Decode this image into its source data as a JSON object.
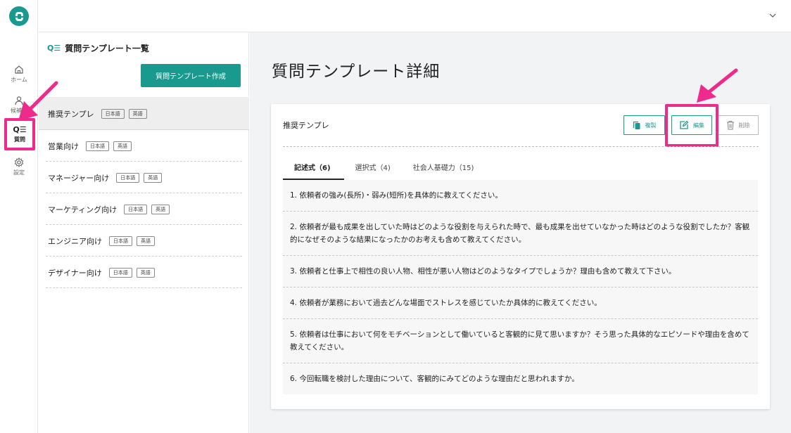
{
  "rail": {
    "items": [
      {
        "label": "ホーム",
        "icon": "home-icon"
      },
      {
        "label": "候補者",
        "icon": "person-icon"
      },
      {
        "label": "質問",
        "icon": "qe-icon",
        "glyph": "Q☰"
      },
      {
        "label": "設定",
        "icon": "gear-icon"
      }
    ]
  },
  "list": {
    "title": "質問テンプレート一覧",
    "title_glyph": "Q☰",
    "create_label": "質問テンプレート作成",
    "items": [
      {
        "name": "推奨テンプレ",
        "tags": [
          "日本語",
          "英語"
        ]
      },
      {
        "name": "営業向け",
        "tags": [
          "日本語",
          "英語"
        ]
      },
      {
        "name": "マネージャー向け",
        "tags": [
          "日本語",
          "英語"
        ]
      },
      {
        "name": "マーケティング向け",
        "tags": [
          "日本語",
          "英語"
        ]
      },
      {
        "name": "エンジニア向け",
        "tags": [
          "日本語",
          "英語"
        ]
      },
      {
        "name": "デザイナー向け",
        "tags": [
          "日本語",
          "英語"
        ]
      }
    ]
  },
  "main": {
    "title": "質問テンプレート詳細",
    "template_name": "推奨テンプレ",
    "actions": {
      "copy": "複製",
      "edit": "編集",
      "delete": "削除"
    },
    "tabs": [
      {
        "label": "記述式（6)"
      },
      {
        "label": "選択式（4)"
      },
      {
        "label": "社会人基礎力（15)"
      }
    ],
    "questions": [
      "1. 依頼者の強み(長所)・弱み(短所)を具体的に教えてください。",
      "2. 依頼者が最も成果を出していた時はどのような役割を与えられた時で、最も成果を出せていなかった時はどのような役割でしたか？客観的になぜそのような結果になったかのお考えも含めて教えてください。",
      "3. 依頼者と仕事上で相性の良い人物、相性が悪い人物はどのようなタイプでしょうか？理由も含めて教えて下さい。",
      "4. 依頼者が業務において過去どんな場面でストレスを感じていたか具体的に教えてください。",
      "5. 依頼者は仕事において何をモチベーションとして働いていると客観的に見て思いますか？そう思った具体的なエピソードや理由を含めて教えてください。",
      "6. 今回転職を検討した理由について、客観的にみてどのような理由だと思われますか。"
    ]
  },
  "colors": {
    "accent": "#1a9a8e",
    "highlight": "#ee2a8c"
  }
}
